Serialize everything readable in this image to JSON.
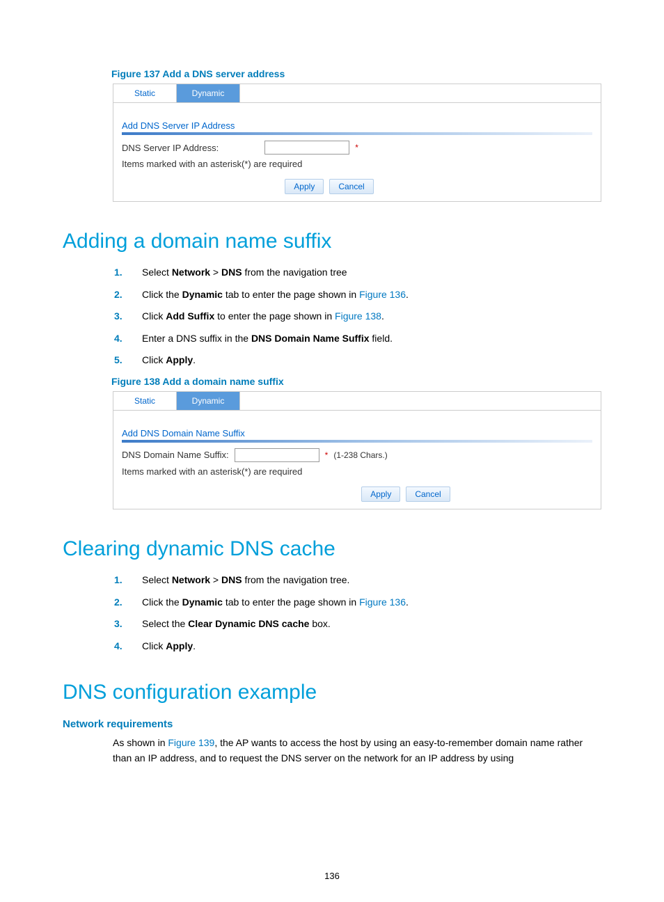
{
  "figure137": {
    "caption": "Figure 137 Add a DNS server address",
    "tabStatic": "Static",
    "tabDynamic": "Dynamic",
    "sectionTitle": "Add DNS Server IP Address",
    "fieldLabel": "DNS Server IP Address:",
    "reqStar": "*",
    "reqNote": "Items marked with an asterisk(*) are required",
    "applyBtn": "Apply",
    "cancelBtn": "Cancel"
  },
  "addingSuffix": {
    "heading": "Adding a domain name suffix",
    "steps": {
      "s1a": "Select ",
      "s1b": "Network",
      "s1c": " > ",
      "s1d": "DNS",
      "s1e": " from the navigation tree",
      "s2a": "Click the ",
      "s2b": "Dynamic",
      "s2c": " tab to enter the page shown in ",
      "s2link": "Figure 136",
      "s2d": ".",
      "s3a": "Click ",
      "s3b": "Add Suffix",
      "s3c": " to enter the page shown in ",
      "s3link": "Figure 138",
      "s3d": ".",
      "s4a": "Enter a DNS suffix in the ",
      "s4b": "DNS Domain Name Suffix",
      "s4c": " field.",
      "s5a": "Click ",
      "s5b": "Apply",
      "s5c": "."
    }
  },
  "figure138": {
    "caption": "Figure 138 Add a domain name suffix",
    "tabStatic": "Static",
    "tabDynamic": "Dynamic",
    "sectionTitle": "Add DNS Domain Name Suffix",
    "fieldLabel": "DNS Domain Name Suffix:",
    "reqStar": "*",
    "chars": "(1-238 Chars.)",
    "reqNote": "Items marked with an asterisk(*) are required",
    "applyBtn": "Apply",
    "cancelBtn": "Cancel"
  },
  "clearingCache": {
    "heading": "Clearing dynamic DNS cache",
    "steps": {
      "s1a": "Select ",
      "s1b": "Network",
      "s1c": " > ",
      "s1d": "DNS",
      "s1e": " from the navigation tree.",
      "s2a": "Click the ",
      "s2b": "Dynamic",
      "s2c": " tab to enter the page shown in ",
      "s2link": "Figure 136",
      "s2d": ".",
      "s3a": "Select the ",
      "s3b": "Clear Dynamic DNS cache",
      "s3c": " box.",
      "s4a": "Click ",
      "s4b": "Apply",
      "s4c": "."
    }
  },
  "configExample": {
    "heading": "DNS configuration example",
    "subhead": "Network requirements",
    "para1a": "As shown in ",
    "para1link": "Figure 139",
    "para1b": ", the AP wants to access the host by using an easy-to-remember domain name rather than an IP address, and to request the DNS server on the network for an IP address by using"
  },
  "pageNumber": "136"
}
